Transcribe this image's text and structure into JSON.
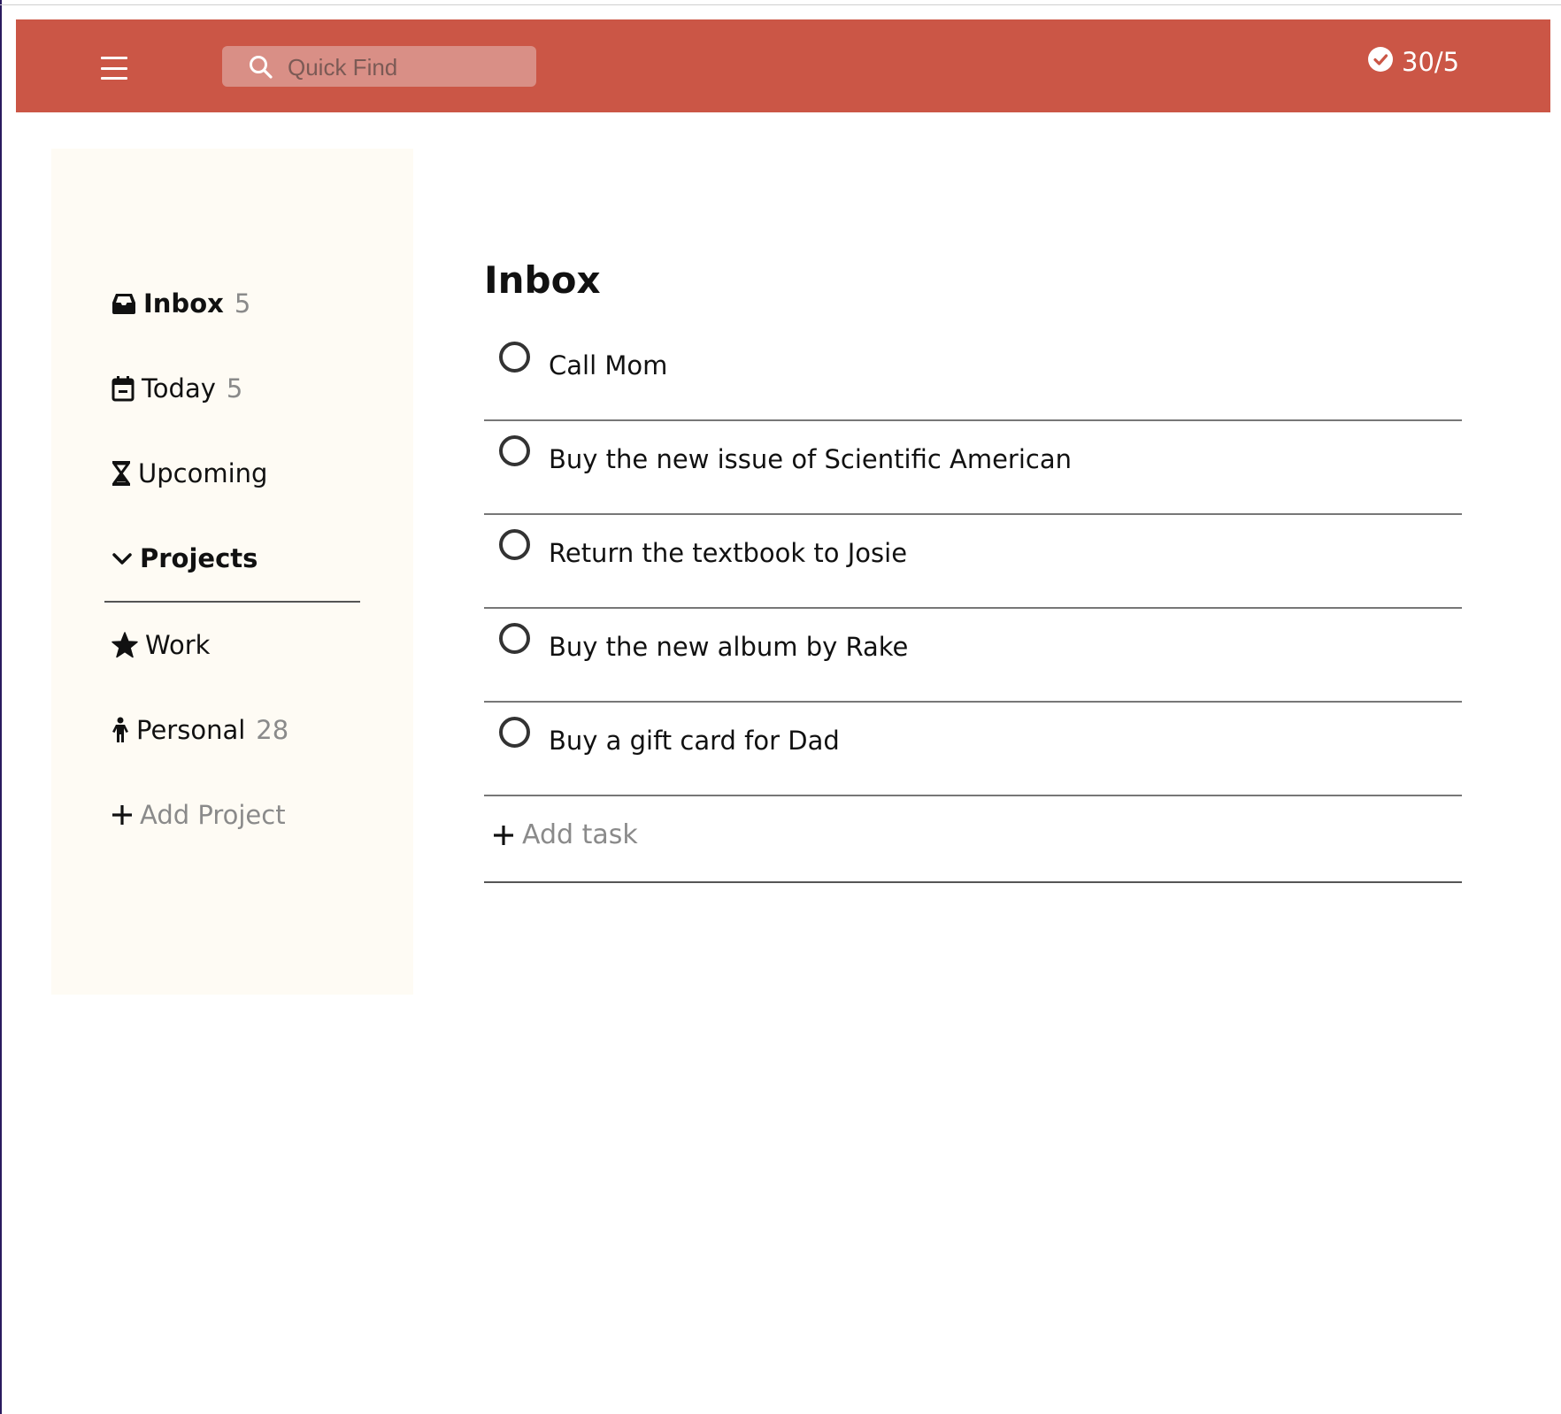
{
  "header": {
    "search_placeholder": "Quick Find",
    "karma": "30/5",
    "colors": {
      "bar": "#cb5646",
      "search_bg": "#d98f86"
    }
  },
  "sidebar": {
    "inbox": {
      "label": "Inbox",
      "count": "5",
      "icon": "inbox-icon"
    },
    "today": {
      "label": "Today",
      "count": "5",
      "icon": "calendar-icon"
    },
    "upcoming": {
      "label": "Upcoming",
      "icon": "hourglass-icon"
    },
    "projects_header": {
      "label": "Projects",
      "icon": "chevron-down-icon"
    },
    "projects": [
      {
        "label": "Work",
        "count": "",
        "icon": "star-icon"
      },
      {
        "label": "Personal",
        "count": "28",
        "icon": "person-icon"
      }
    ],
    "add_project": "Add Project",
    "colors": {
      "bg": "#fefbf4"
    }
  },
  "main": {
    "title": "Inbox",
    "tasks": [
      "Call Mom",
      "Buy the new issue of Scientific American",
      "Return the textbook to Josie",
      "Buy the new album by Rake",
      "Buy a gift card for Dad"
    ],
    "add_task": "Add task"
  }
}
